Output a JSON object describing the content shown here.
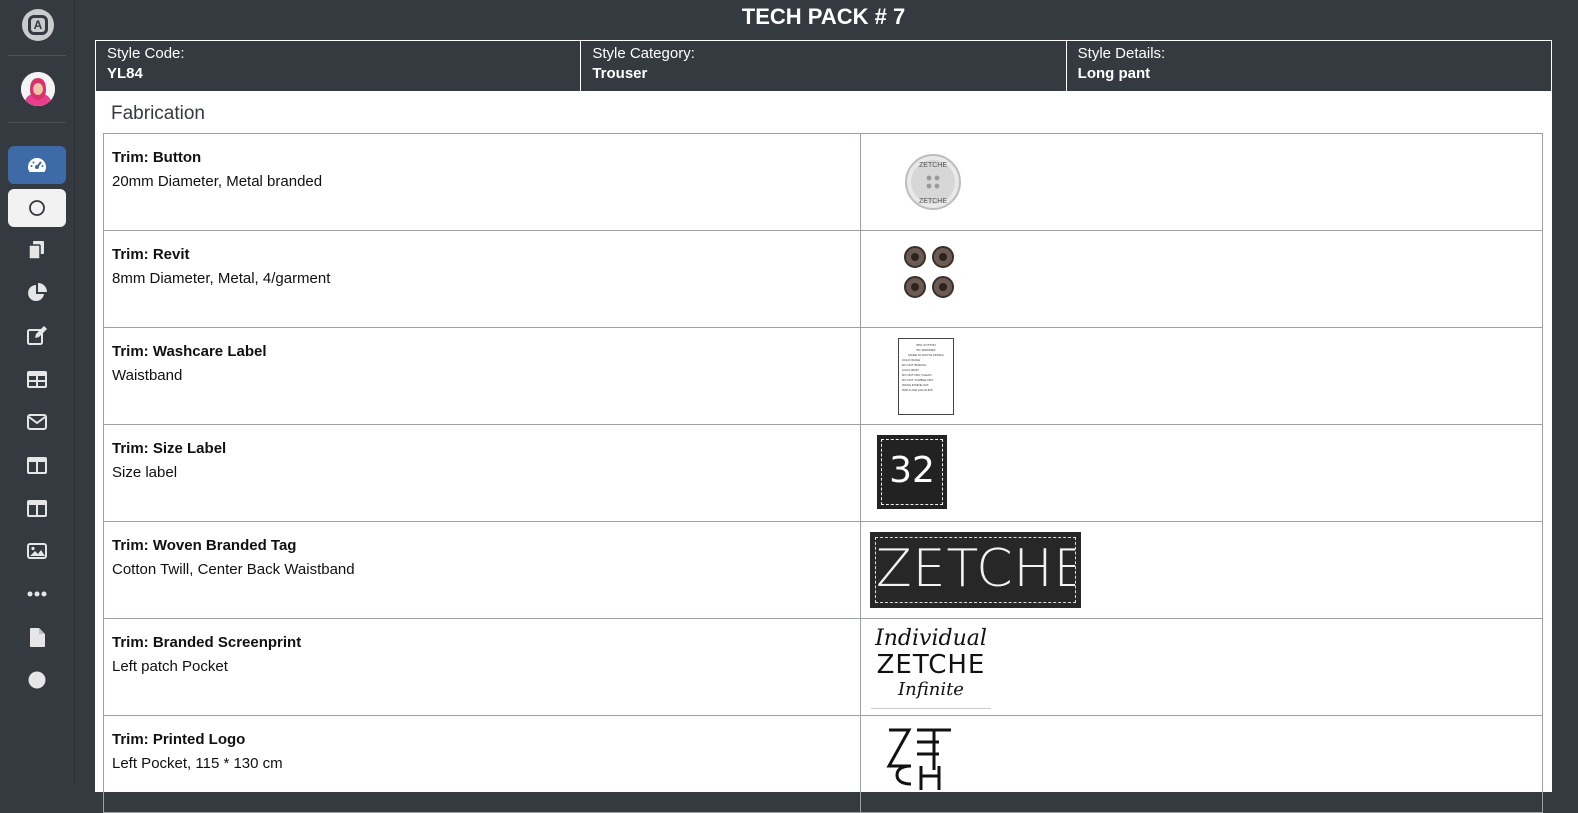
{
  "page": {
    "title": "TECH PACK # 7"
  },
  "header": {
    "style_code": {
      "label": "Style Code:",
      "value": "YL84"
    },
    "style_category": {
      "label": "Style Category:",
      "value": "Trouser"
    },
    "style_details": {
      "label": "Style Details:",
      "value": "Long pant"
    }
  },
  "section": {
    "title": "Fabrication"
  },
  "trims": [
    {
      "name": "Trim: Button",
      "desc": "20mm Diameter, Metal branded"
    },
    {
      "name": "Trim: Revit",
      "desc": "8mm Diameter, Metal, 4/garment"
    },
    {
      "name": "Trim: Washcare Label",
      "desc": "Waistband"
    },
    {
      "name": "Trim: Size Label",
      "desc": "Size label"
    },
    {
      "name": "Trim: Woven Branded Tag",
      "desc": "Cotton Twill, Center Back Waistband"
    },
    {
      "name": "Trim: Branded Screenprint",
      "desc": "Left patch Pocket"
    },
    {
      "name": "Trim: Printed Logo",
      "desc": "Left Pocket, 115 * 130 cm"
    }
  ],
  "images": {
    "button_text": "ZETCHE",
    "size_label_text": "32",
    "woven_tag_text": "ZETCHE",
    "screenprint_top": "Individual",
    "screenprint_mid": "ZETCHE",
    "screenprint_bottom": "Infinite",
    "washcare_lines": [
      "95% COTTON",
      "5% SPANDEX",
      "MADE IN SOUTH AFRICA",
      "COLD WASH",
      "DO NOT BLEACH",
      "COOL IRON",
      "DO NOT DRY CLEAN",
      "DO NOT TUMBLE DRY",
      "WASH INSIDE OUT",
      "WITH LIKE COLOURS"
    ]
  },
  "sidebar": {
    "icons": [
      "dashboard-icon",
      "circle-icon",
      "copy-icon",
      "pie-chart-icon",
      "edit-icon",
      "table-icon",
      "mail-icon",
      "columns-icon",
      "columns-icon",
      "image-icon",
      "more-icon",
      "file-icon",
      "dot-icon"
    ]
  },
  "colors": {
    "sidebar": "#343a40",
    "active": "#3e6aa8",
    "text": "#ffffff"
  }
}
